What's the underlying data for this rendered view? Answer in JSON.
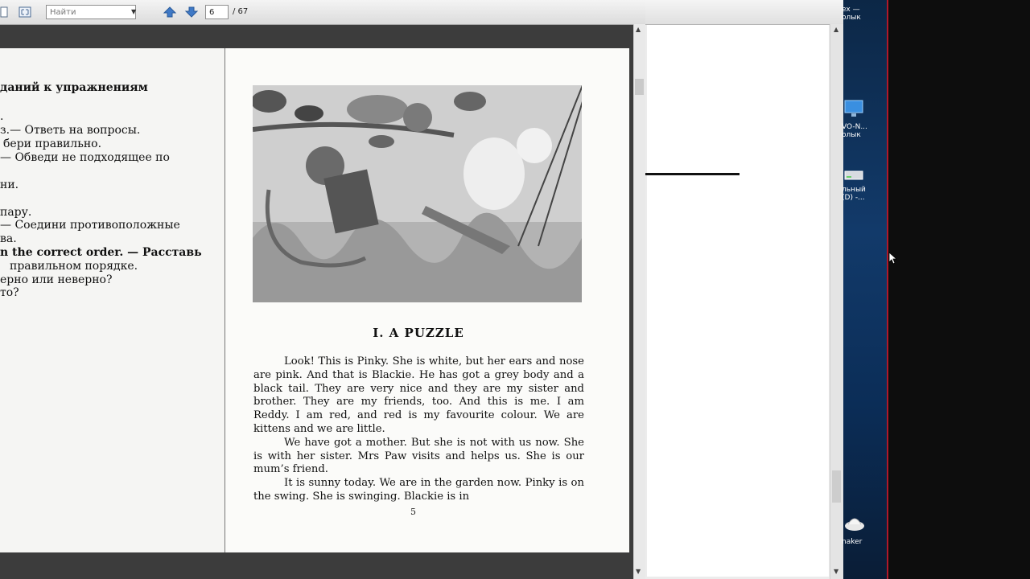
{
  "toolbar": {
    "search_placeholder": "Найти",
    "current_page": "6",
    "total_pages": "/ 67"
  },
  "left_page": {
    "heading": "даний к упражнениям",
    "lines": [
      ".",
      "з.— Ответь на вопросы.",
      "бери правильно.",
      "— Обведи не подходящее по",
      "ни.",
      "пару.",
      "— Соедини противоположные",
      "ва.",
      "n the correct order. — Расставь",
      "правильном порядке.",
      "ерно или неверно?",
      "то?"
    ]
  },
  "right_page": {
    "title": "I. A PUZZLE",
    "paragraphs": [
      "Look! This is Pinky. She is white, but her ears and nose are pink. And that is Blackie. He has got a grey body and a black tail. They are very nice and they are my sister and brother. They are my friends, too. And this is me. I am Reddy. I am red, and red is my favourite colour. We are kittens and we are little.",
      "We have got a mother. But she is not with us now. She is with her sister. Mrs Paw visits and helps us. She is our mum’s friend.",
      "It is sunny today. We are in the garden now. Pinky is on the swing. She is swinging. Blackie is in"
    ],
    "page_number": "5"
  },
  "desktop": {
    "icons": [
      {
        "label": "ex —\nолык",
        "icon": "folder-icon"
      },
      {
        "label": "VO-N...\nолык",
        "icon": "monitor-icon"
      },
      {
        "label": "льный\n(D) -...",
        "icon": "drive-icon"
      },
      {
        "label": "naker",
        "icon": "app-icon"
      }
    ]
  }
}
